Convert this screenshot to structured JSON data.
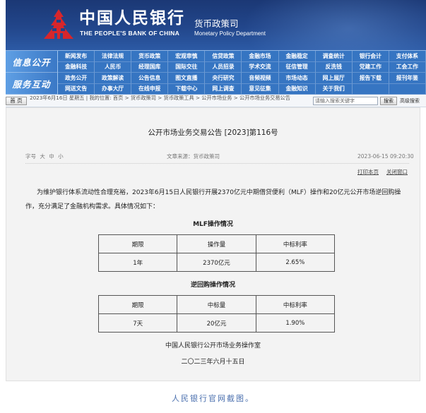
{
  "colors": {
    "header_bg": "#22468b",
    "nav_bg": "#3675c2",
    "logo_red": "#d7262b",
    "content_bg": "#f3f3f3",
    "caption": "#4a6fae"
  },
  "header": {
    "logo_icon": "pboc-emblem-icon",
    "title_cn": "中国人民银行",
    "title_en": "THE PEOPLE'S BANK OF CHINA",
    "dept_cn": "货币政策司",
    "dept_en": "Monetary Policy Department"
  },
  "nav": {
    "group1_label": "信息公开",
    "group2_label": "服务互动",
    "rows": [
      [
        "新闻发布",
        "法律法规",
        "货币政策",
        "宏观审慎",
        "信贷政策",
        "金融市场",
        "金融稳定",
        "调查统计",
        "银行会计",
        "支付体系"
      ],
      [
        "金融科技",
        "人民币",
        "经理国库",
        "国际交往",
        "人员招录",
        "学术交流",
        "征信管理",
        "反洗钱",
        "党建工作",
        "工会工作"
      ],
      [
        "政务公开",
        "政策解读",
        "公告信息",
        "图文直播",
        "央行研究",
        "音频视频",
        "市场动态",
        "网上展厅",
        "报告下载",
        "报刊年鉴"
      ],
      [
        "网送文告",
        "办事大厅",
        "在线申报",
        "下载中心",
        "网上调查",
        "意见征集",
        "金融知识",
        "关于我们"
      ]
    ]
  },
  "toolbar": {
    "home_label": "首 页",
    "date": "2023年6月16日 星期五",
    "divider": "|",
    "location_label": "我的位置:",
    "separator": ">",
    "breadcrumb": [
      "首页",
      "货币政策司",
      "货币政策工具",
      "公开市场业务",
      "公开市场业务交易公告"
    ],
    "search_placeholder": "请输入搜索关键字",
    "search_button": "搜索",
    "advanced_search": "高级搜索"
  },
  "article": {
    "title": "公开市场业务交易公告 [2023]第116号",
    "font_size_label": "字号",
    "font_sizes": [
      "大",
      "中",
      "小"
    ],
    "source_label": "文章来源：",
    "source": "货币政策司",
    "datetime": "2023-06-15 09:20:30",
    "print_label": "打印本页",
    "close_label": "关闭窗口",
    "body": "为维护银行体系流动性合理充裕，2023年6月15日人民银行开展2370亿元中期借贷便利（MLF）操作和20亿元公开市场逆回购操作，充分满足了金融机构需求。具体情况如下：",
    "mlf": {
      "heading": "MLF操作情况",
      "columns": [
        "期限",
        "操作量",
        "中标利率"
      ],
      "rows": [
        [
          "1年",
          "2370亿元",
          "2.65%"
        ]
      ]
    },
    "reverse_repo": {
      "heading": "逆回购操作情况",
      "columns": [
        "期限",
        "中标量",
        "中标利率"
      ],
      "rows": [
        [
          "7天",
          "20亿元",
          "1.90%"
        ]
      ]
    },
    "signature": "中国人民银行公开市场业务操作室",
    "date": "二〇二三年六月十五日"
  },
  "caption": "人民银行官网截图。"
}
